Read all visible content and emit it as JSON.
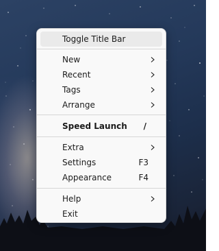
{
  "menu": {
    "items": [
      {
        "label": "Toggle Title Bar"
      },
      {
        "label": "New"
      },
      {
        "label": "Recent"
      },
      {
        "label": "Tags"
      },
      {
        "label": "Arrange"
      },
      {
        "label": "Speed Launch",
        "shortcut": "/"
      },
      {
        "label": "Extra"
      },
      {
        "label": "Settings",
        "shortcut": "F3"
      },
      {
        "label": "Appearance",
        "shortcut": "F4"
      },
      {
        "label": "Help"
      },
      {
        "label": "Exit"
      }
    ]
  },
  "colors": {
    "menu_background": "#f9f9f9",
    "highlight": "#eaeaea",
    "separator": "#d6d6d6",
    "text": "#1a1a1a"
  },
  "icons": {
    "submenu": "chevron-right-icon"
  }
}
